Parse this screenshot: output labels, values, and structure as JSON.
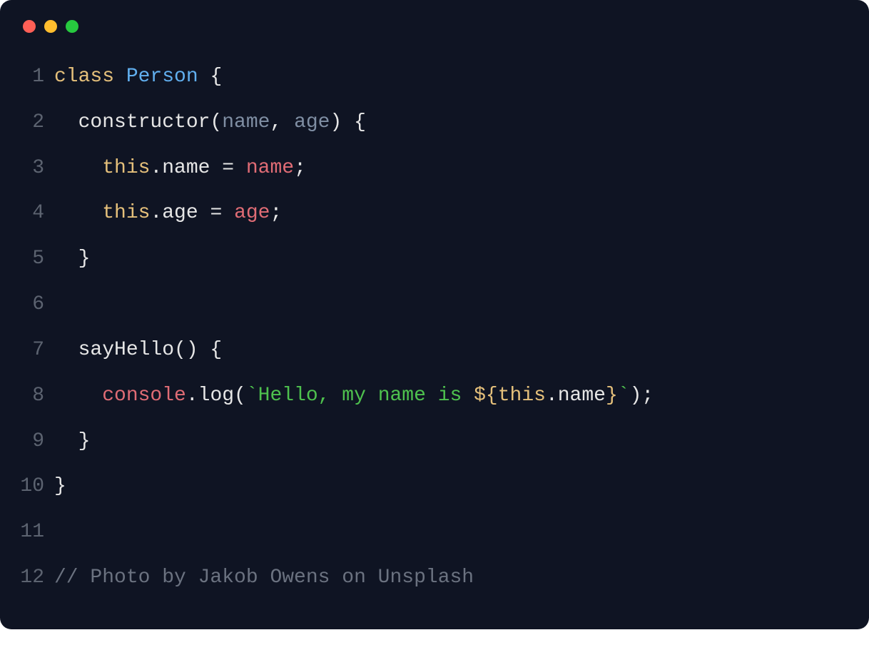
{
  "window_controls": {
    "close": "close",
    "minimize": "minimize",
    "maximize": "maximize"
  },
  "code": {
    "lines": [
      {
        "no": "1",
        "tokens": [
          [
            "keyword",
            "class "
          ],
          [
            "class",
            "Person"
          ],
          [
            "default",
            " {"
          ]
        ]
      },
      {
        "no": "2",
        "tokens": [
          [
            "default",
            "  constructor("
          ],
          [
            "param",
            "name"
          ],
          [
            "default",
            ", "
          ],
          [
            "param",
            "age"
          ],
          [
            "default",
            ") {"
          ]
        ]
      },
      {
        "no": "3",
        "tokens": [
          [
            "default",
            "    "
          ],
          [
            "this",
            "this"
          ],
          [
            "default",
            ".name = "
          ],
          [
            "assign",
            "name"
          ],
          [
            "default",
            ";"
          ]
        ]
      },
      {
        "no": "4",
        "tokens": [
          [
            "default",
            "    "
          ],
          [
            "this",
            "this"
          ],
          [
            "default",
            ".age = "
          ],
          [
            "assign",
            "age"
          ],
          [
            "default",
            ";"
          ]
        ]
      },
      {
        "no": "5",
        "tokens": [
          [
            "default",
            "  }"
          ]
        ]
      },
      {
        "no": "6",
        "tokens": [
          [
            "default",
            ""
          ]
        ]
      },
      {
        "no": "7",
        "tokens": [
          [
            "default",
            "  sayHello() {"
          ]
        ]
      },
      {
        "no": "8",
        "tokens": [
          [
            "default",
            "    "
          ],
          [
            "obj",
            "console"
          ],
          [
            "default",
            ".log("
          ],
          [
            "string",
            "`Hello, my name is "
          ],
          [
            "interp",
            "${"
          ],
          [
            "this",
            "this"
          ],
          [
            "default",
            ".name"
          ],
          [
            "interp",
            "}"
          ],
          [
            "string",
            "`"
          ],
          [
            "default",
            ");"
          ]
        ]
      },
      {
        "no": "9",
        "tokens": [
          [
            "default",
            "  }"
          ]
        ]
      },
      {
        "no": "10",
        "tokens": [
          [
            "default",
            "}"
          ]
        ]
      },
      {
        "no": "11",
        "tokens": [
          [
            "default",
            ""
          ]
        ]
      },
      {
        "no": "12",
        "tokens": [
          [
            "comment",
            "// Photo by Jakob Owens on Unsplash"
          ]
        ]
      }
    ]
  }
}
